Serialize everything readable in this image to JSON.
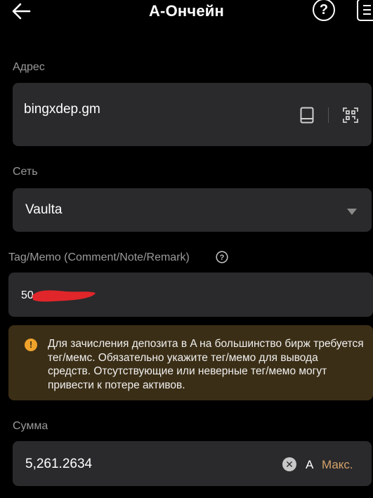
{
  "header": {
    "title": "A-Ончейн",
    "help_icon_glyph": "?",
    "back_icon": "arrow-left-icon",
    "menu_icon": "menu-icon"
  },
  "address": {
    "label": "Адрес",
    "value": "bingxdep.gm",
    "address_book_icon": "address-book-icon",
    "scan_icon": "qr-scan-icon"
  },
  "network": {
    "label": "Сеть",
    "value": "Vaulta",
    "dropdown_icon": "caret-down-icon"
  },
  "memo": {
    "label": "Tag/Memo (Comment/Note/Remark)",
    "value_visible": "50",
    "help_icon": "question-circle-icon"
  },
  "warning": {
    "icon_glyph": "!",
    "text": "Для зачисления депозита в A на большинство бирж требуется тег/мемс. Обязательно укажите тег/мемо для вывода средств. Отсутствующие или неверные тег/мемо могут привести к потере активов."
  },
  "amount": {
    "label": "Сумма",
    "value": "5,261.2634",
    "clear_icon_glyph": "✕",
    "currency": "A",
    "max_label": "Макс."
  },
  "colors": {
    "background": "#000000",
    "field_bg": "#2a2a2c",
    "label_gray": "#9a9a9a",
    "warning_bg": "#3b2e16",
    "warning_icon": "#f0a32b",
    "max_accent": "#d4a26a",
    "redaction": "#e0262a"
  }
}
